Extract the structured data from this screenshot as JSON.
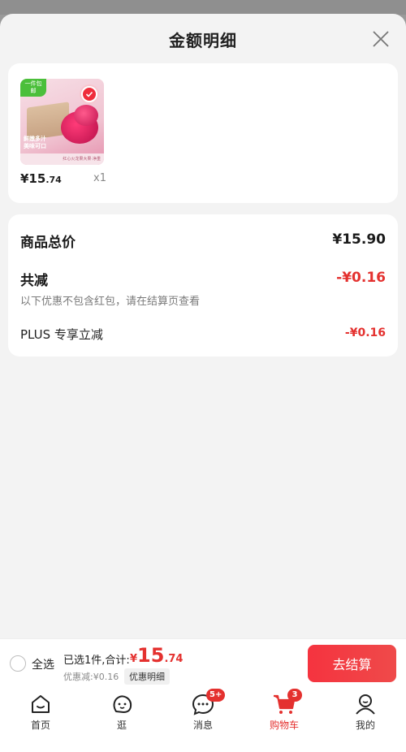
{
  "sheet": {
    "title": "金额明细",
    "close_icon": "close-icon"
  },
  "product": {
    "ribbon": "一件包邮",
    "caption": "鲜嫩多汁 美味可口",
    "strip": "红心火龙果大果·净重",
    "price_int": "¥15",
    "price_dec": ".74",
    "qty": "x1"
  },
  "summary": {
    "total_label": "商品总价",
    "total_value": "¥15.90",
    "discount_label": "共减",
    "discount_value": "-¥0.16",
    "note": "以下优惠不包含红包，请在结算页查看",
    "plus_label": "PLUS 专享立减",
    "plus_value": "-¥0.16"
  },
  "checkout": {
    "select_all": "全选",
    "selected_text": "已选1件,合计:",
    "currency": "¥",
    "amount_int": "15",
    "amount_dec": ".74",
    "discount_line": "优惠减:¥0.16",
    "detail_tag": "优惠明细",
    "button": "去结算"
  },
  "tabbar": {
    "tabs": [
      {
        "label": "首页",
        "icon": "home-icon"
      },
      {
        "label": "逛",
        "icon": "face-icon"
      },
      {
        "label": "消息",
        "icon": "message-icon",
        "badge": "5+"
      },
      {
        "label": "购物车",
        "icon": "cart-icon",
        "badge": "3",
        "active": true
      },
      {
        "label": "我的",
        "icon": "user-icon"
      }
    ]
  },
  "colors": {
    "accent": "#e4312f",
    "sheet_bg": "#f3f3f3",
    "card_bg": "#ffffff"
  }
}
